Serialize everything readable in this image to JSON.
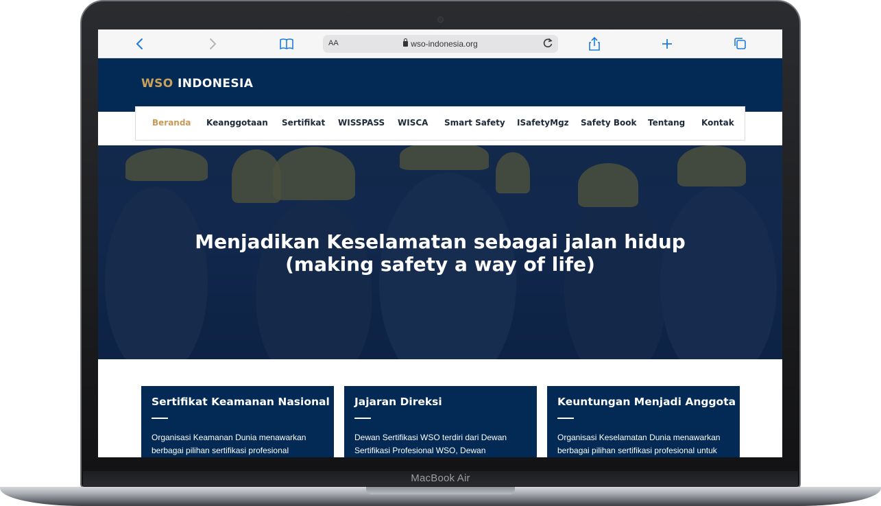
{
  "device": {
    "label": "MacBook Air"
  },
  "browser": {
    "text_size_label": "AA",
    "url": "wso-indonesia.org",
    "icons": [
      "back-icon",
      "forward-icon",
      "bookmarks-icon",
      "lock-icon",
      "reload-icon",
      "share-icon",
      "new-tab-icon",
      "tabs-icon"
    ]
  },
  "site": {
    "brand_part1": "WSO",
    "brand_part2": "INDONESIA",
    "nav": [
      {
        "label": "Beranda",
        "active": true
      },
      {
        "label": "Keanggotaan"
      },
      {
        "label": "Sertifikat"
      },
      {
        "label": "WISSPASS"
      },
      {
        "label": "WISCA"
      },
      {
        "label": "Smart Safety"
      },
      {
        "label": "ISafetyMgz"
      },
      {
        "label": "Safety Book"
      },
      {
        "label": "Tentang"
      },
      {
        "label": "Kontak"
      }
    ],
    "hero": {
      "line1": "Menjadikan Keselamatan sebagai jalan hidup",
      "line2": "(making safety a way of life)"
    },
    "cards": [
      {
        "title": "Sertifikat Keamanan Nasional",
        "text": "Organisasi Keamanan Dunia menawarkan berbagai pilihan sertifikasi profesional"
      },
      {
        "title": "Jajaran Direksi",
        "text": "Dewan Sertifikasi WSO terdiri dari Dewan Sertifikasi Profesional WSO, Dewan"
      },
      {
        "title": "Keuntungan Menjadi Anggota",
        "text": "Organisasi Keselamatan Dunia menawarkan berbagai pilihan sertifikasi profesional untuk"
      }
    ]
  },
  "colors": {
    "navy": "#022a55",
    "gold": "#c9a15a",
    "link_blue": "#1b7bdc"
  }
}
